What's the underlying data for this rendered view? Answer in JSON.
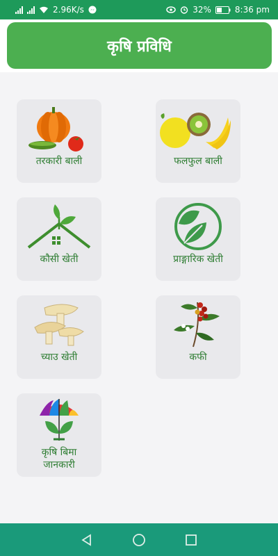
{
  "status": {
    "speed": "2.96K/s",
    "battery": "32%",
    "time": "8:36 pm"
  },
  "header": {
    "title": "कृषि प्रविधि"
  },
  "tiles": [
    {
      "label": "तरकारी बाली",
      "icon": "vegetables-icon"
    },
    {
      "label": "फलफुल बाली",
      "icon": "fruits-icon"
    },
    {
      "label": "कौसी खेती",
      "icon": "rooftop-farming-icon"
    },
    {
      "label": "प्राङ्गारिक खेती",
      "icon": "organic-leaf-icon"
    },
    {
      "label": "च्याउ खेती",
      "icon": "mushroom-icon"
    },
    {
      "label": "कफी",
      "icon": "coffee-plant-icon"
    },
    {
      "label": "कृषि बिमा जानकारी",
      "label_line1": "कृषि बिमा",
      "label_line2": "जानकारी",
      "icon": "crop-insurance-icon"
    }
  ],
  "colors": {
    "status_bar": "#1e9a5a",
    "header": "#4caf50",
    "tile": "#e9e9ec",
    "label": "#2e7d32",
    "nav_bar": "#1a9a7a"
  }
}
